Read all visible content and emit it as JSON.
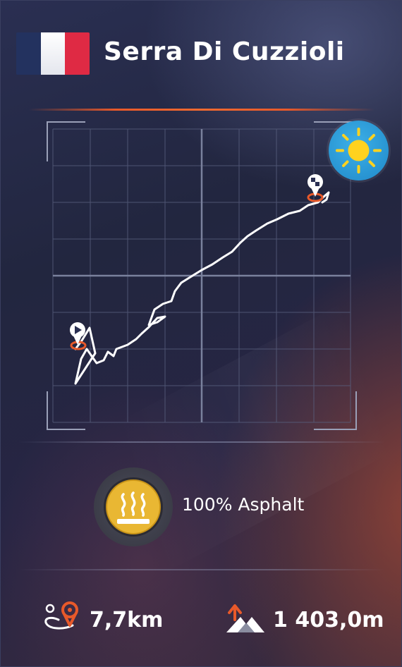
{
  "track": {
    "name": "Serra Di Cuzzioli",
    "country_flag": "france-flag",
    "flag_colors": [
      "#23325f",
      "#ffffff",
      "#df2a44"
    ]
  },
  "weather": {
    "icon": "sun-icon",
    "colors": {
      "badge": "#2a9ad8",
      "sun": "#ffd21f"
    }
  },
  "map": {
    "start_marker_icon": "start-flag-icon",
    "finish_marker_icon": "finish-flag-icon",
    "marker_accent": "#e8592a",
    "route_color": "#ffffff"
  },
  "surface": {
    "icon": "asphalt-icon",
    "label": "100% Asphalt",
    "badge_color": "#e9b733"
  },
  "stats": {
    "distance": {
      "icon": "distance-icon",
      "value": "7,7km"
    },
    "elevation": {
      "icon": "elevation-gain-icon",
      "value": "1 403,0m"
    }
  },
  "colors": {
    "accent": "#e8592a",
    "text": "#ffffff",
    "background": "#22263f"
  }
}
